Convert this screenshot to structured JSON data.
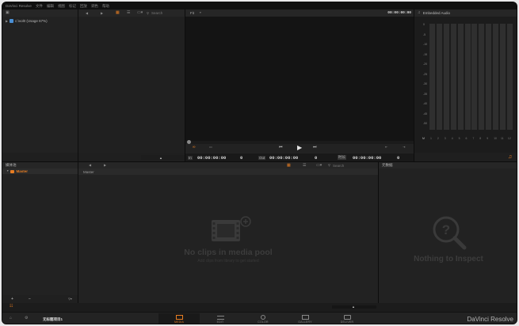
{
  "menubar": {
    "items": [
      "DaVinci Resolve",
      "文件",
      "编辑",
      "视图",
      "标记",
      "回放",
      "调色",
      "帮助"
    ]
  },
  "media_storage": {
    "volume": "c:\\vol0 (Usage 67%)"
  },
  "browser_toolbar": {
    "search_label": "Search"
  },
  "viewer": {
    "fit_label": "Fit",
    "timecode_top": "00:00:00:00",
    "in_label": "In",
    "in_tc": "00:00:00:00",
    "in_frames": "0",
    "out_label": "Out",
    "out_tc": "00:00:00:00",
    "out_frames": "0",
    "dur_label": "时长",
    "dur_tc": "00:00:00:00",
    "dur_frames": "0"
  },
  "audio": {
    "title": "Embedded Audio",
    "scale": [
      "0",
      "-5",
      "-10",
      "-15",
      "-20",
      "-25",
      "-30",
      "-35",
      "-40",
      "-45",
      "-50"
    ],
    "channels": [
      "M",
      "1",
      "2",
      "3",
      "4",
      "5",
      "6",
      "7",
      "8",
      "9",
      "10",
      "11",
      "12"
    ]
  },
  "media_pool": {
    "header": "媒体池",
    "folder": "Master",
    "list_header": "Master",
    "search_label": "Search",
    "empty_title": "No clips in media pool",
    "empty_subtitle": "Add clips from library to get started"
  },
  "metadata": {
    "header": "元数据",
    "empty_title": "Nothing to Inspect"
  },
  "footer": {
    "project_name": "无标题项目1",
    "brand": "DaVinci Resolve",
    "tabs": [
      {
        "label": "MEDIA",
        "icon": "media-icon",
        "active": true
      },
      {
        "label": "EDIT",
        "icon": "edit-icon",
        "active": false
      },
      {
        "label": "COLOR",
        "icon": "color-icon",
        "active": false
      },
      {
        "label": "GALLERY",
        "icon": "gallery-icon",
        "active": false
      },
      {
        "label": "DELIVER",
        "icon": "deliver-icon",
        "active": false
      }
    ]
  },
  "colors": {
    "accent": "#e77d22",
    "background": "#1f1f1f",
    "panel": "#222222",
    "folder_blue": "#4a8fd4"
  }
}
